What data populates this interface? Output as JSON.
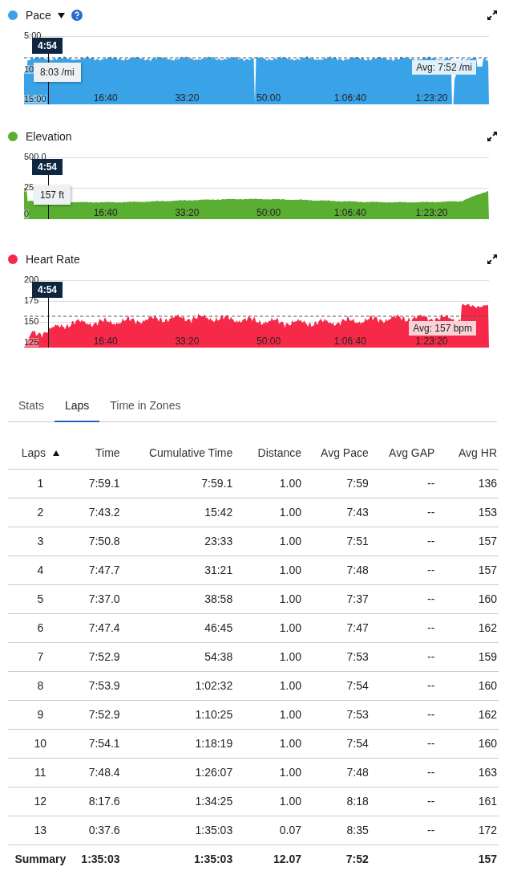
{
  "charts": [
    {
      "kind": "pace",
      "title": "Pace",
      "color": "#3aa3e8",
      "y_ticks": [
        "5:00",
        "10",
        "15:00"
      ],
      "x_ticks": [
        "16:40",
        "33:20",
        "50:00",
        "1:06:40",
        "1:23:20"
      ],
      "cursor_label": "4:54",
      "tooltip": "8:03 /mi",
      "avg_label": "Avg: 7:52 /mi"
    },
    {
      "kind": "elevation",
      "title": "Elevation",
      "color": "#5aaf33",
      "y_ticks": [
        "500.0",
        "25",
        "0"
      ],
      "x_ticks": [
        "16:40",
        "33:20",
        "50:00",
        "1:06:40",
        "1:23:20"
      ],
      "cursor_label": "4:54",
      "tooltip": "157 ft"
    },
    {
      "kind": "heart_rate",
      "title": "Heart Rate",
      "color": "#f62a48",
      "y_ticks": [
        "200",
        "175",
        "150",
        "125"
      ],
      "x_ticks": [
        "16:40",
        "33:20",
        "50:00",
        "1:06:40",
        "1:23:20"
      ],
      "cursor_label": "4:54",
      "avg_label": "Avg: 157 bpm"
    }
  ],
  "tabs": [
    {
      "label": "Stats",
      "selected": false
    },
    {
      "label": "Laps",
      "selected": true
    },
    {
      "label": "Time in Zones",
      "selected": false
    }
  ],
  "table": {
    "columns": [
      {
        "label": "Laps",
        "sorted": true
      },
      {
        "label": "Time",
        "sorted": false
      },
      {
        "label": "Cumulative Time",
        "sorted": false
      },
      {
        "label": "Distance",
        "sorted": false
      },
      {
        "label": "Avg Pace",
        "sorted": false
      },
      {
        "label": "Avg GAP",
        "sorted": false
      },
      {
        "label": "Avg HR",
        "sorted": false
      }
    ],
    "rows": [
      [
        "1",
        "7:59.1",
        "7:59.1",
        "1.00",
        "7:59",
        "--",
        "136"
      ],
      [
        "2",
        "7:43.2",
        "15:42",
        "1.00",
        "7:43",
        "--",
        "153"
      ],
      [
        "3",
        "7:50.8",
        "23:33",
        "1.00",
        "7:51",
        "--",
        "157"
      ],
      [
        "4",
        "7:47.7",
        "31:21",
        "1.00",
        "7:48",
        "--",
        "157"
      ],
      [
        "5",
        "7:37.0",
        "38:58",
        "1.00",
        "7:37",
        "--",
        "160"
      ],
      [
        "6",
        "7:47.4",
        "46:45",
        "1.00",
        "7:47",
        "--",
        "162"
      ],
      [
        "7",
        "7:52.9",
        "54:38",
        "1.00",
        "7:53",
        "--",
        "159"
      ],
      [
        "8",
        "7:53.9",
        "1:02:32",
        "1.00",
        "7:54",
        "--",
        "160"
      ],
      [
        "9",
        "7:52.9",
        "1:10:25",
        "1.00",
        "7:53",
        "--",
        "162"
      ],
      [
        "10",
        "7:54.1",
        "1:18:19",
        "1.00",
        "7:54",
        "--",
        "160"
      ],
      [
        "11",
        "7:48.4",
        "1:26:07",
        "1.00",
        "7:48",
        "--",
        "163"
      ],
      [
        "12",
        "8:17.6",
        "1:34:25",
        "1.00",
        "8:18",
        "--",
        "161"
      ],
      [
        "13",
        "0:37.6",
        "1:35:03",
        "0.07",
        "8:35",
        "--",
        "172"
      ]
    ],
    "summary": {
      "laps": "Summary",
      "time": "1:35:03",
      "cumulative_time": "1:35:03",
      "distance": "12.07",
      "avg_pace": "7:52",
      "avg_hr": "157"
    }
  }
}
